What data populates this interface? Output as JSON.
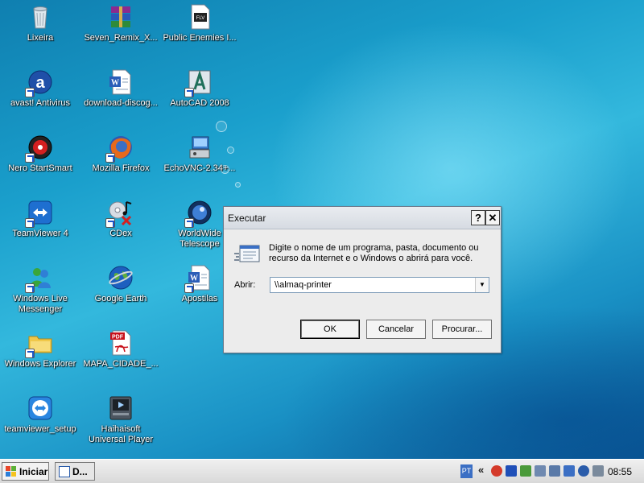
{
  "desktop": {
    "icons": [
      {
        "label": "Lixeira",
        "icon": "recycle-bin-icon"
      },
      {
        "label": "Seven_Remix_X...",
        "icon": "winrar-archive-icon"
      },
      {
        "label": "Public Enemies I...",
        "icon": "video-file-icon"
      },
      {
        "label": "avast! Antivirus",
        "icon": "avast-icon"
      },
      {
        "label": "download-discog...",
        "icon": "word-document-icon"
      },
      {
        "label": "AutoCAD 2008",
        "icon": "autocad-icon"
      },
      {
        "label": "Nero StartSmart",
        "icon": "nero-icon"
      },
      {
        "label": "Mozilla Firefox",
        "icon": "firefox-icon"
      },
      {
        "label": "EchoVNC-2.34+...",
        "icon": "installer-icon"
      },
      {
        "label": "TeamViewer 4",
        "icon": "teamviewer-icon"
      },
      {
        "label": "CDex",
        "icon": "cdex-icon"
      },
      {
        "label": "WorldWide\nTelescope",
        "icon": "worldwide-telescope-icon"
      },
      {
        "label": "Windows Live\nMessenger",
        "icon": "messenger-icon"
      },
      {
        "label": "Google Earth",
        "icon": "google-earth-icon"
      },
      {
        "label": "Apostilas",
        "icon": "word-document-icon"
      },
      {
        "label": "Windows Explorer",
        "icon": "windows-explorer-icon"
      },
      {
        "label": "MAPA_CIDADE_...",
        "icon": "pdf-icon"
      },
      {
        "label": "teamviewer_setup",
        "icon": "teamviewer-icon"
      },
      {
        "label": "Haihaisoft\nUniversal Player",
        "icon": "media-player-icon"
      }
    ]
  },
  "dialog": {
    "title": "Executar",
    "help_label": "?",
    "close_label": "✕",
    "description": "Digite o nome de um programa, pasta, documento ou recurso da Internet e o Windows o abrirá para você.",
    "open_label": "Abrir:",
    "open_value": "\\\\almaq-printer",
    "ok_label": "OK",
    "cancel_label": "Cancelar",
    "browse_label": "Procurar..."
  },
  "taskbar": {
    "start_label": "Iniciar",
    "task_label": "D...",
    "language": "PT",
    "tray_expand": "«",
    "clock": "08:55"
  },
  "colors": {
    "accent": "#1c56c8",
    "desktop": "#1a9fcc"
  }
}
